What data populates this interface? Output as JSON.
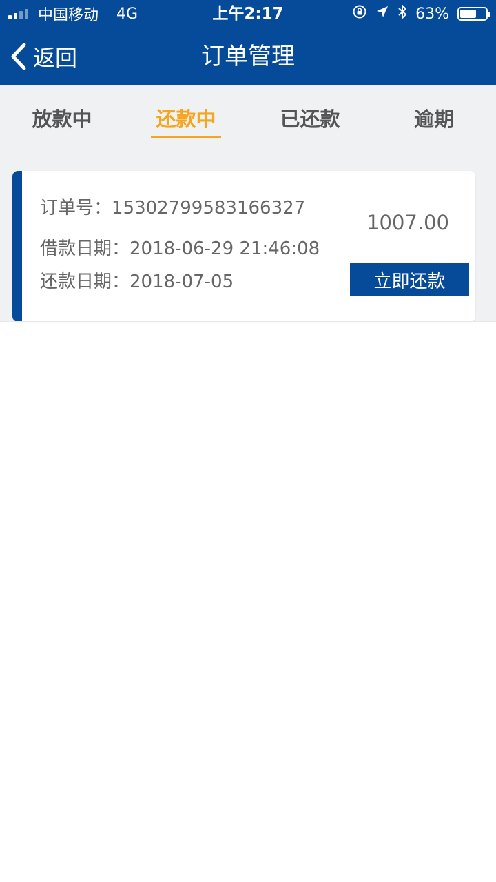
{
  "status_bar": {
    "carrier": "中国移动",
    "network": "4G",
    "time": "上午2:17",
    "battery_percent": "63%",
    "battery_level": 0.63,
    "icons": [
      "signal-icon",
      "rotation-lock-icon",
      "location-arrow-icon",
      "bluetooth-icon",
      "battery-icon"
    ]
  },
  "nav": {
    "back_label": "返回",
    "title": "订单管理"
  },
  "tabs": [
    {
      "label": "放款中",
      "active": false
    },
    {
      "label": "还款中",
      "active": true
    },
    {
      "label": "已还款",
      "active": false
    },
    {
      "label": "逾期",
      "active": false
    }
  ],
  "order": {
    "order_no_label": "订单号：",
    "order_no": "15302799583166327",
    "loan_date_label": "借款日期：",
    "loan_date": "2018-06-29 21:46:08",
    "repay_date_label": "还款日期：",
    "repay_date": "2018-07-05",
    "amount": "1007.00",
    "pay_button": "立即还款"
  },
  "colors": {
    "primary": "#064a9a",
    "accent": "#f5a51e",
    "tab_text": "#555555",
    "card_text": "#666666",
    "background": "#f0f1f3"
  }
}
